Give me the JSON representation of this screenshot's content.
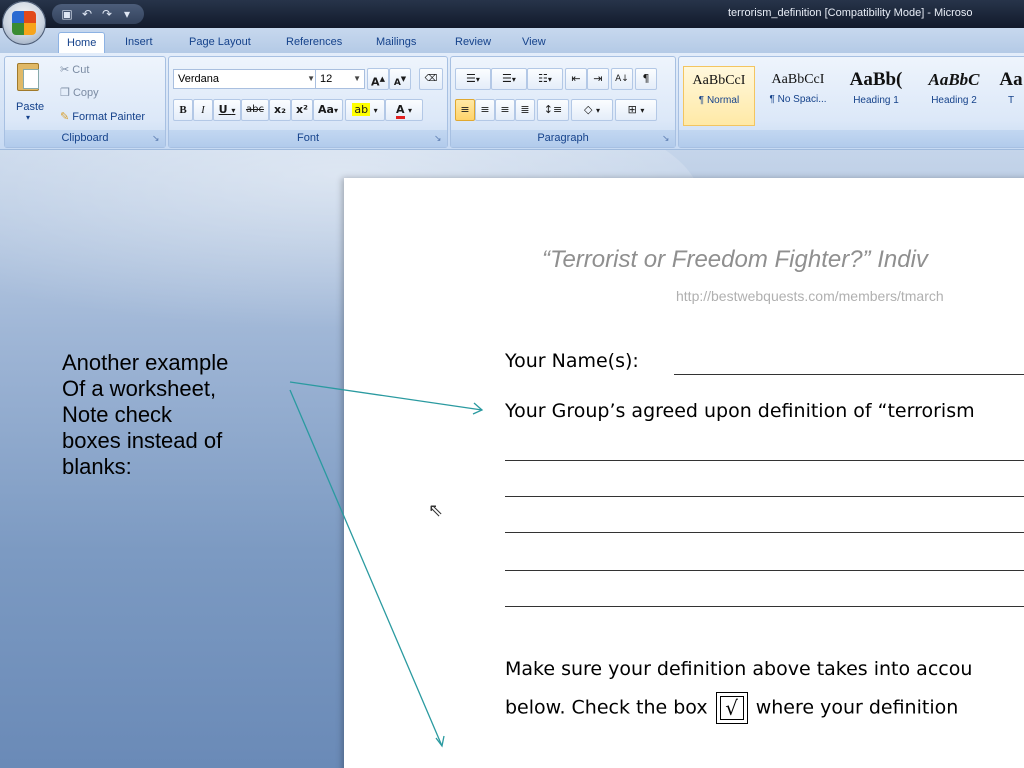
{
  "window": {
    "title": "terrorism_definition [Compatibility Mode] - Microso",
    "quick_access": [
      "save-icon",
      "undo-icon",
      "redo-icon",
      "customize-icon"
    ]
  },
  "tabs": [
    "Home",
    "Insert",
    "Page Layout",
    "References",
    "Mailings",
    "Review",
    "View"
  ],
  "ribbon": {
    "clipboard": {
      "label": "Clipboard",
      "paste": "Paste",
      "cut": "Cut",
      "copy": "Copy",
      "format_painter": "Format Painter"
    },
    "font": {
      "label": "Font",
      "font_name": "Verdana",
      "font_size": "12",
      "bold": "B",
      "italic": "I",
      "underline": "U",
      "strike": "abc",
      "subscript": "x₂",
      "superscript": "x²",
      "change_case": "Aa",
      "grow": "A",
      "shrink": "A"
    },
    "paragraph": {
      "label": "Paragraph"
    },
    "styles": [
      {
        "preview": "AaBbCcI",
        "name": "¶ Normal",
        "selected": true
      },
      {
        "preview": "AaBbCcI",
        "name": "¶ No Spaci...",
        "selected": false
      },
      {
        "preview": "AaBb(",
        "name": "Heading 1",
        "selected": false
      },
      {
        "preview": "AaBbC",
        "name": "Heading 2",
        "selected": false
      },
      {
        "preview": "Aa",
        "name": "T",
        "selected": false
      }
    ]
  },
  "document": {
    "title": "“Terrorist or Freedom Fighter?”  Indiv",
    "url": "http://bestwebquests.com/members/tmarch",
    "name_prompt": "Your Name(s):",
    "definition_prompt": "Your Group’s agreed upon definition of “terrorism",
    "instruction_line1": "Make sure your definition above takes into accou",
    "instruction_line2_before": "below.  Check the box",
    "check_mark": "√",
    "instruction_line2_after": "where your definition"
  },
  "annotation": {
    "lines": [
      "Another example",
      "Of a worksheet,",
      "Note check",
      "boxes instead of",
      "blanks:"
    ],
    "arrow_color": "#2a9aa0"
  }
}
